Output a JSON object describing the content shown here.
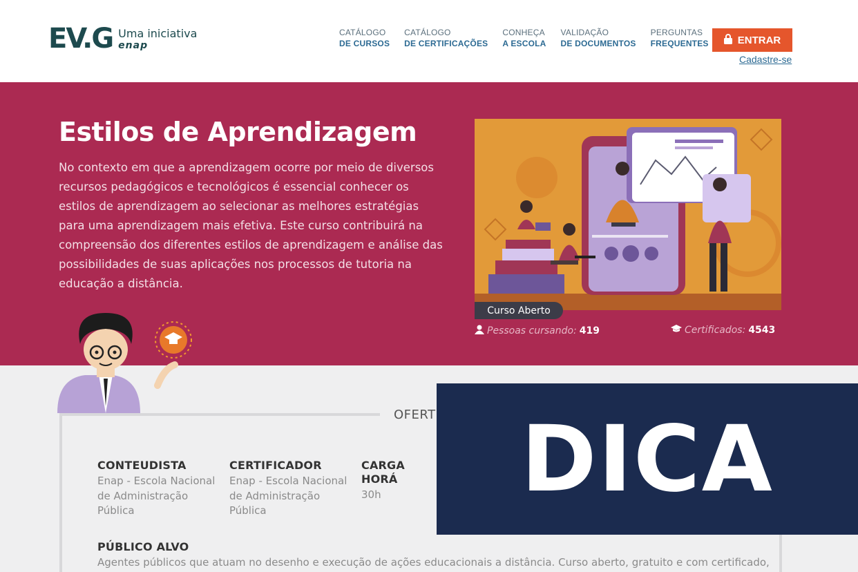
{
  "header": {
    "logo_mark": "EV.G",
    "logo_tagline": "Uma iniciativa",
    "logo_org": "enap",
    "nav": [
      {
        "line1": "CATÁLOGO",
        "line2": "DE CURSOS"
      },
      {
        "line1": "CATÁLOGO",
        "line2": "DE CERTIFICAÇÕES"
      },
      {
        "line1": "CONHEÇA",
        "line2": "A ESCOLA"
      },
      {
        "line1": "VALIDAÇÃO",
        "line2": "DE DOCUMENTOS"
      },
      {
        "line1": "PERGUNTAS",
        "line2": "FREQUENTES"
      }
    ],
    "login_label": "ENTRAR",
    "signup_label": "Cadastre-se"
  },
  "hero": {
    "title": "Estilos de Aprendizagem",
    "description": "No contexto em que a aprendizagem ocorre por meio de diversos recursos pedagógicos e tecnológicos é essencial conhecer os estilos de aprendizagem ao selecionar as melhores estratégias para uma aprendizagem mais efetiva. Este curso contribuirá na compreensão dos diferentes estilos de aprendizagem e análise das possibilidades de suas aplicações nos processos de tutoria na educação a distância.",
    "badge": "Curso Aberto",
    "students_label": "Pessoas cursando:",
    "students_value": "419",
    "certificates_label": "Certificados:",
    "certificates_value": "4543"
  },
  "content": {
    "section_label": "OFERT",
    "fields": [
      {
        "heading": "CONTEUDISTA",
        "value": "Enap - Escola Nacional de Administração Pública"
      },
      {
        "heading": "CERTIFICADOR",
        "value": "Enap - Escola Nacional de Administração Pública"
      },
      {
        "heading": "CARGA HORÁ",
        "value": "30h"
      },
      {
        "heading": "PÚBLICO ALVO",
        "value": "Agentes públicos que atuam no desenho e execução de ações educacionais a distância. Curso aberto, gratuito e com certificado,"
      }
    ]
  },
  "overlay": {
    "text": "DICA"
  },
  "colors": {
    "hero_bg": "#ab2a52",
    "brand_dark": "#1d4a4e",
    "nav_blue": "#2c6a93",
    "cta_orange": "#e5562c",
    "overlay_navy": "#1b2b4f",
    "illustration_orange": "#e29a39"
  },
  "icons": {
    "login": "lock-icon",
    "students": "user-icon",
    "certificates": "graduation-cap-icon"
  }
}
